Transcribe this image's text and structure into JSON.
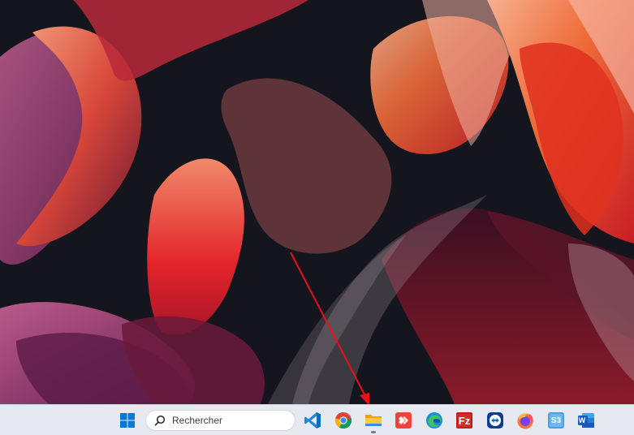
{
  "taskbar": {
    "search": {
      "placeholder": "Rechercher",
      "value": ""
    },
    "pinned_apps": [
      {
        "name": "start",
        "icon": "windows-logo-icon"
      },
      {
        "name": "vscode",
        "icon": "vscode-icon"
      },
      {
        "name": "chrome",
        "icon": "chrome-icon"
      },
      {
        "name": "file-explorer",
        "icon": "folder-icon",
        "running": true
      },
      {
        "name": "anydesk",
        "icon": "anydesk-icon"
      },
      {
        "name": "edge",
        "icon": "edge-icon"
      },
      {
        "name": "filezilla",
        "icon": "filezilla-icon"
      },
      {
        "name": "teamviewer",
        "icon": "teamviewer-icon"
      },
      {
        "name": "firefox",
        "icon": "firefox-icon"
      },
      {
        "name": "s3",
        "icon": "s3-browser-icon",
        "label": "S3"
      },
      {
        "name": "word",
        "icon": "word-icon",
        "label": "W"
      }
    ]
  },
  "annotation": {
    "type": "arrow",
    "color": "#e8121b",
    "target": "file-explorer"
  },
  "colors": {
    "taskbar_bg": "#e6e9f0",
    "wallpaper_bg": "#14151d",
    "accent_red": "#e8121b"
  }
}
